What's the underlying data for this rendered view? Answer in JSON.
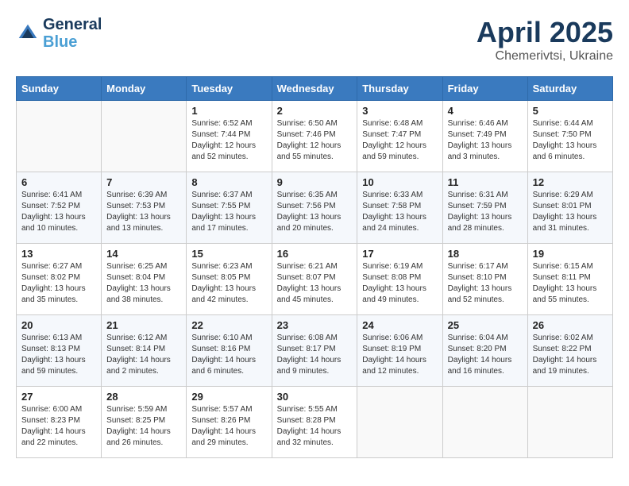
{
  "logo": {
    "line1": "General",
    "line2": "Blue"
  },
  "title": {
    "month": "April 2025",
    "location": "Chemerivtsi, Ukraine"
  },
  "weekdays": [
    "Sunday",
    "Monday",
    "Tuesday",
    "Wednesday",
    "Thursday",
    "Friday",
    "Saturday"
  ],
  "weeks": [
    [
      {
        "day": "",
        "sunrise": "",
        "sunset": "",
        "daylight": ""
      },
      {
        "day": "",
        "sunrise": "",
        "sunset": "",
        "daylight": ""
      },
      {
        "day": "1",
        "sunrise": "Sunrise: 6:52 AM",
        "sunset": "Sunset: 7:44 PM",
        "daylight": "Daylight: 12 hours and 52 minutes."
      },
      {
        "day": "2",
        "sunrise": "Sunrise: 6:50 AM",
        "sunset": "Sunset: 7:46 PM",
        "daylight": "Daylight: 12 hours and 55 minutes."
      },
      {
        "day": "3",
        "sunrise": "Sunrise: 6:48 AM",
        "sunset": "Sunset: 7:47 PM",
        "daylight": "Daylight: 12 hours and 59 minutes."
      },
      {
        "day": "4",
        "sunrise": "Sunrise: 6:46 AM",
        "sunset": "Sunset: 7:49 PM",
        "daylight": "Daylight: 13 hours and 3 minutes."
      },
      {
        "day": "5",
        "sunrise": "Sunrise: 6:44 AM",
        "sunset": "Sunset: 7:50 PM",
        "daylight": "Daylight: 13 hours and 6 minutes."
      }
    ],
    [
      {
        "day": "6",
        "sunrise": "Sunrise: 6:41 AM",
        "sunset": "Sunset: 7:52 PM",
        "daylight": "Daylight: 13 hours and 10 minutes."
      },
      {
        "day": "7",
        "sunrise": "Sunrise: 6:39 AM",
        "sunset": "Sunset: 7:53 PM",
        "daylight": "Daylight: 13 hours and 13 minutes."
      },
      {
        "day": "8",
        "sunrise": "Sunrise: 6:37 AM",
        "sunset": "Sunset: 7:55 PM",
        "daylight": "Daylight: 13 hours and 17 minutes."
      },
      {
        "day": "9",
        "sunrise": "Sunrise: 6:35 AM",
        "sunset": "Sunset: 7:56 PM",
        "daylight": "Daylight: 13 hours and 20 minutes."
      },
      {
        "day": "10",
        "sunrise": "Sunrise: 6:33 AM",
        "sunset": "Sunset: 7:58 PM",
        "daylight": "Daylight: 13 hours and 24 minutes."
      },
      {
        "day": "11",
        "sunrise": "Sunrise: 6:31 AM",
        "sunset": "Sunset: 7:59 PM",
        "daylight": "Daylight: 13 hours and 28 minutes."
      },
      {
        "day": "12",
        "sunrise": "Sunrise: 6:29 AM",
        "sunset": "Sunset: 8:01 PM",
        "daylight": "Daylight: 13 hours and 31 minutes."
      }
    ],
    [
      {
        "day": "13",
        "sunrise": "Sunrise: 6:27 AM",
        "sunset": "Sunset: 8:02 PM",
        "daylight": "Daylight: 13 hours and 35 minutes."
      },
      {
        "day": "14",
        "sunrise": "Sunrise: 6:25 AM",
        "sunset": "Sunset: 8:04 PM",
        "daylight": "Daylight: 13 hours and 38 minutes."
      },
      {
        "day": "15",
        "sunrise": "Sunrise: 6:23 AM",
        "sunset": "Sunset: 8:05 PM",
        "daylight": "Daylight: 13 hours and 42 minutes."
      },
      {
        "day": "16",
        "sunrise": "Sunrise: 6:21 AM",
        "sunset": "Sunset: 8:07 PM",
        "daylight": "Daylight: 13 hours and 45 minutes."
      },
      {
        "day": "17",
        "sunrise": "Sunrise: 6:19 AM",
        "sunset": "Sunset: 8:08 PM",
        "daylight": "Daylight: 13 hours and 49 minutes."
      },
      {
        "day": "18",
        "sunrise": "Sunrise: 6:17 AM",
        "sunset": "Sunset: 8:10 PM",
        "daylight": "Daylight: 13 hours and 52 minutes."
      },
      {
        "day": "19",
        "sunrise": "Sunrise: 6:15 AM",
        "sunset": "Sunset: 8:11 PM",
        "daylight": "Daylight: 13 hours and 55 minutes."
      }
    ],
    [
      {
        "day": "20",
        "sunrise": "Sunrise: 6:13 AM",
        "sunset": "Sunset: 8:13 PM",
        "daylight": "Daylight: 13 hours and 59 minutes."
      },
      {
        "day": "21",
        "sunrise": "Sunrise: 6:12 AM",
        "sunset": "Sunset: 8:14 PM",
        "daylight": "Daylight: 14 hours and 2 minutes."
      },
      {
        "day": "22",
        "sunrise": "Sunrise: 6:10 AM",
        "sunset": "Sunset: 8:16 PM",
        "daylight": "Daylight: 14 hours and 6 minutes."
      },
      {
        "day": "23",
        "sunrise": "Sunrise: 6:08 AM",
        "sunset": "Sunset: 8:17 PM",
        "daylight": "Daylight: 14 hours and 9 minutes."
      },
      {
        "day": "24",
        "sunrise": "Sunrise: 6:06 AM",
        "sunset": "Sunset: 8:19 PM",
        "daylight": "Daylight: 14 hours and 12 minutes."
      },
      {
        "day": "25",
        "sunrise": "Sunrise: 6:04 AM",
        "sunset": "Sunset: 8:20 PM",
        "daylight": "Daylight: 14 hours and 16 minutes."
      },
      {
        "day": "26",
        "sunrise": "Sunrise: 6:02 AM",
        "sunset": "Sunset: 8:22 PM",
        "daylight": "Daylight: 14 hours and 19 minutes."
      }
    ],
    [
      {
        "day": "27",
        "sunrise": "Sunrise: 6:00 AM",
        "sunset": "Sunset: 8:23 PM",
        "daylight": "Daylight: 14 hours and 22 minutes."
      },
      {
        "day": "28",
        "sunrise": "Sunrise: 5:59 AM",
        "sunset": "Sunset: 8:25 PM",
        "daylight": "Daylight: 14 hours and 26 minutes."
      },
      {
        "day": "29",
        "sunrise": "Sunrise: 5:57 AM",
        "sunset": "Sunset: 8:26 PM",
        "daylight": "Daylight: 14 hours and 29 minutes."
      },
      {
        "day": "30",
        "sunrise": "Sunrise: 5:55 AM",
        "sunset": "Sunset: 8:28 PM",
        "daylight": "Daylight: 14 hours and 32 minutes."
      },
      {
        "day": "",
        "sunrise": "",
        "sunset": "",
        "daylight": ""
      },
      {
        "day": "",
        "sunrise": "",
        "sunset": "",
        "daylight": ""
      },
      {
        "day": "",
        "sunrise": "",
        "sunset": "",
        "daylight": ""
      }
    ]
  ]
}
